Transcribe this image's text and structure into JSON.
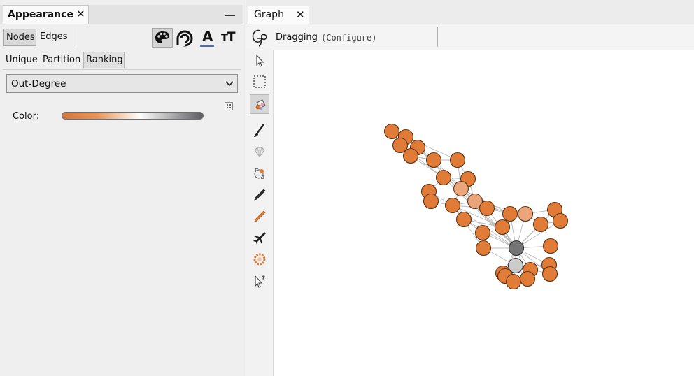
{
  "appearance_panel": {
    "tab_title": "Appearance",
    "tab_close": "✕",
    "minimize": "—",
    "element_tabs": {
      "nodes": "Nodes",
      "edges": "Edges"
    },
    "transformer_icons": [
      "palette-icon",
      "size-icon",
      "label-color-icon",
      "label-size-icon"
    ],
    "label_color_glyph": "A",
    "label_size_glyph": "тT",
    "sub_tabs": {
      "unique": "Unique",
      "partition": "Partition",
      "ranking": "Ranking"
    },
    "selected_sub_tab": "Ranking",
    "attribute": "Out-Degree",
    "color_label": "Color:",
    "gradient_colors": [
      "#d9773a",
      "#e89455",
      "#ffffff",
      "#c9c9c9",
      "#5c5c62"
    ]
  },
  "graph_window": {
    "tab_title": "Graph",
    "tab_close": "✕",
    "mode_label": "Dragging",
    "configure_label": "(Configure)",
    "tools": [
      "pointer-icon",
      "rectangle-select-icon",
      "paint-bucket-icon",
      "brush-icon",
      "diamond-icon",
      "node-size-icon",
      "pencil-icon",
      "edge-pencil-icon",
      "airplane-icon",
      "heatmap-icon",
      "help-pointer-icon"
    ],
    "colors": {
      "node_orange": "#e07b38",
      "node_light_orange": "#eaa57a",
      "node_dark_gray": "#747476",
      "node_light_gray": "#cccccc",
      "node_stroke": "#5a3416",
      "edge": "#b8b8b8"
    }
  }
}
